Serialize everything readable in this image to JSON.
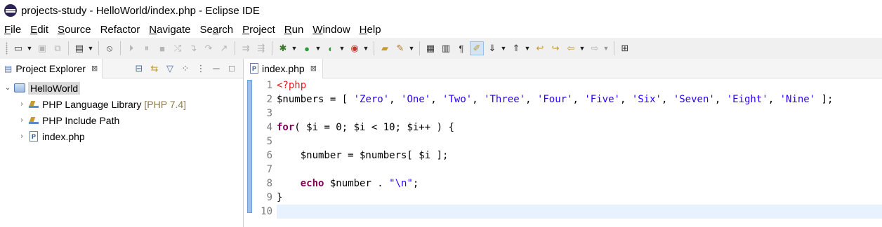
{
  "window": {
    "title": "projects-study - HelloWorld/index.php - Eclipse IDE"
  },
  "menu": [
    {
      "label": "File",
      "mnemonic": "F",
      "rest": "ile"
    },
    {
      "label": "Edit",
      "mnemonic": "E",
      "rest": "dit"
    },
    {
      "label": "Source",
      "mnemonic": "S",
      "rest": "ource"
    },
    {
      "label": "Refactor",
      "mnemonic": "",
      "rest": "Refactor"
    },
    {
      "label": "Navigate",
      "mnemonic": "N",
      "rest": "avigate"
    },
    {
      "label": "Search",
      "mnemonic": "a",
      "rest": "rch",
      "prefix": "Se"
    },
    {
      "label": "Project",
      "mnemonic": "P",
      "rest": "roject"
    },
    {
      "label": "Run",
      "mnemonic": "R",
      "rest": "un"
    },
    {
      "label": "Window",
      "mnemonic": "W",
      "rest": "indow"
    },
    {
      "label": "Help",
      "mnemonic": "H",
      "rest": "elp"
    }
  ],
  "explorer": {
    "tab_label": "Project Explorer",
    "close_glyph": "⊠",
    "tree": [
      {
        "label": "HelloWorld",
        "icon": "php-project-icon",
        "expanded": true
      },
      {
        "label": "PHP Language Library",
        "decoration": "[PHP 7.4]",
        "icon": "library-icon"
      },
      {
        "label": "PHP Include Path",
        "icon": "library-icon"
      },
      {
        "label": "index.php",
        "icon": "php-file-icon"
      }
    ]
  },
  "editor": {
    "tab_label": "index.php",
    "close_glyph": "⊠",
    "line_numbers": [
      "1",
      "2",
      "3",
      "4",
      "5",
      "6",
      "7",
      "8",
      "9",
      "10"
    ],
    "current_line": 10,
    "code": {
      "l1": "<?php",
      "l2_var": "$numbers",
      "l2_a": " = [ ",
      "strings": [
        "'Zero'",
        "'One'",
        "'Two'",
        "'Three'",
        "'Four'",
        "'Five'",
        "'Six'",
        "'Seven'",
        "'Eight'",
        "'Nine'"
      ],
      "l2_end": " ];",
      "l4_kw": "for",
      "l4_rest": "( $i = 0; $i < 10; $i++ ) {",
      "l6": "    $number = $numbers[ $i ];",
      "l8_indent": "    ",
      "l8_kw": "echo",
      "l8_mid": " $number . ",
      "l8_str": "\"\\n\"",
      "l8_end": ";",
      "l9": "}"
    }
  },
  "colors": {
    "keyword": "#7f0055",
    "php_tag": "#e51a1a",
    "string": "#2a00ff",
    "current_line": "#e8f2fe"
  }
}
